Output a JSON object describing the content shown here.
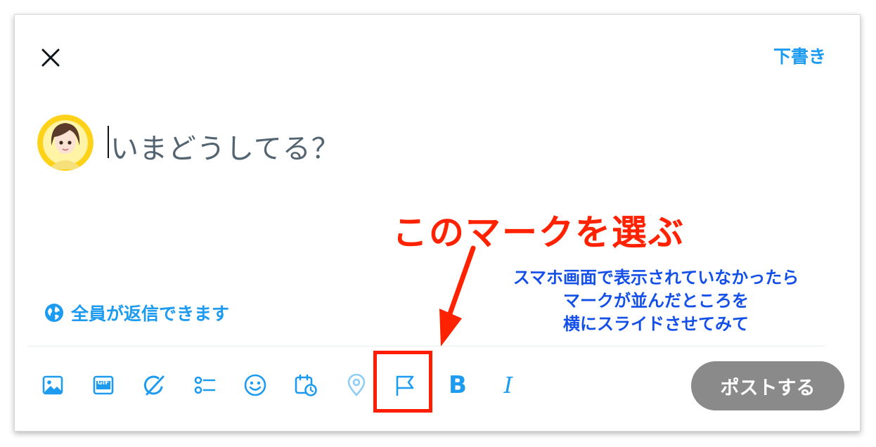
{
  "header": {
    "drafts_label": "下書き"
  },
  "compose": {
    "placeholder": "いまどうしてる？"
  },
  "reply_setting": {
    "label": "全員が返信できます"
  },
  "annotation": {
    "title": "このマークを選ぶ",
    "note_lines": [
      "スマホ画面で表示されていなかったら",
      "マークが並んだところを",
      "横にスライドさせてみて"
    ]
  },
  "toolbar": {
    "gif_label": "GIF",
    "bold_label": "B",
    "italic_label": "I",
    "post_label": "ポストする"
  },
  "colors": {
    "accent": "#1d9bf0",
    "annotation_red": "#ff2200",
    "annotation_blue": "#1450e8",
    "post_disabled": "#8a8a8a"
  }
}
